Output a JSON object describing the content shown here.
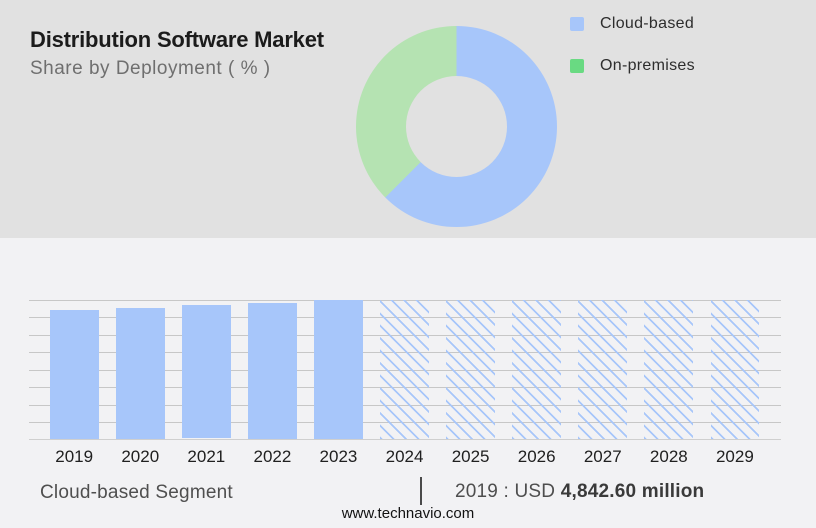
{
  "header": {
    "title": "Distribution Software Market",
    "subtitle": "Share by Deployment ( % )"
  },
  "legend": [
    {
      "label": "Cloud-based",
      "color": "#a7c6fa"
    },
    {
      "label": "On-premises",
      "color": "#69da82"
    }
  ],
  "footer": {
    "segment_label": "Cloud-based Segment",
    "divider": "|",
    "value_prefix": "2019 : USD ",
    "value_bold": "4,842.60 million",
    "website": "www.technavio.com"
  },
  "colors": {
    "header_background": "#e1e1e1",
    "chart_background": "#f2f2f4",
    "bar_blue": "#a7c6fa",
    "donut_green": "#b5e3b2",
    "legend_green": "#69da82",
    "gridline": "#c7c7c7"
  },
  "chart_data": [
    {
      "type": "pie",
      "donut": true,
      "title": "Share by Deployment ( % )",
      "labels": [
        "Cloud-based",
        "On-premises"
      ],
      "values_pct_estimated": [
        62.5,
        37.5
      ],
      "colors": [
        "#a7c6fa",
        "#b5e3b2"
      ],
      "start_angle_deg": 0,
      "direction": "clockwise",
      "legend_position": "right"
    },
    {
      "type": "bar",
      "categories": [
        "2019",
        "2020",
        "2021",
        "2022",
        "2023",
        "2024",
        "2025",
        "2026",
        "2027",
        "2028",
        "2029"
      ],
      "series": [
        {
          "name": "Cloud-based Segment",
          "values_gridline_units": [
            7.4,
            7.5,
            7.66,
            7.8,
            8.0,
            7.95,
            7.95,
            7.95,
            7.95,
            7.95,
            7.95
          ]
        }
      ],
      "historical_categories": [
        "2019",
        "2020",
        "2021",
        "2022",
        "2023"
      ],
      "forecast_categories_hatched": [
        "2024",
        "2025",
        "2026",
        "2027",
        "2028",
        "2029"
      ],
      "bar_color": "#a7c6fa",
      "gridline_count": 8,
      "y_axis_labels_visible": false,
      "annotation": "2019 : USD 4,842.60 million"
    }
  ]
}
